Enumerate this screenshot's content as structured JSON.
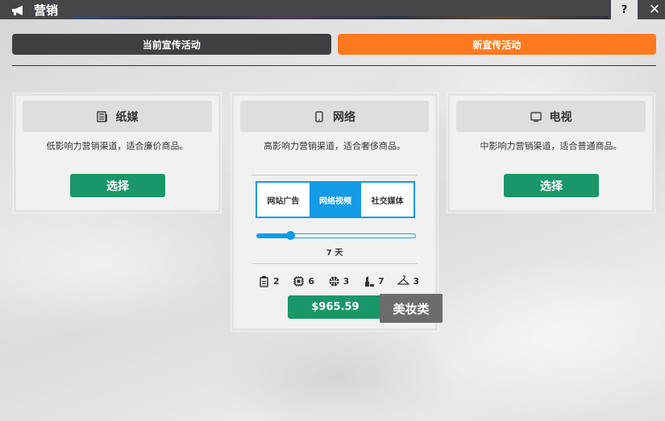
{
  "window": {
    "title": "营销",
    "icon": "megaphone-icon",
    "help_label": "?",
    "close_label": "✕"
  },
  "tabs": [
    {
      "label": "当前宣传活动",
      "active": false
    },
    {
      "label": "新宣传活动",
      "active": true,
      "color": "#ff7a1f"
    }
  ],
  "channels": [
    {
      "name": "纸媒",
      "icon": "newspaper-icon",
      "description": "低影响力营销渠道，适合廉价商品。",
      "button_label": "选择"
    },
    {
      "name": "网络",
      "icon": "smartphone-icon",
      "description": "高影响力营销渠道，适合奢侈商品。",
      "options": [
        "网站广告",
        "网络视频",
        "社交媒体"
      ],
      "selected_option": "网络视频",
      "duration": {
        "value": 7,
        "label": "7 天",
        "fraction": 0.21
      },
      "stats": [
        {
          "icon": "clipboard-icon",
          "value": "2"
        },
        {
          "icon": "chip-icon",
          "value": "6"
        },
        {
          "icon": "basketball-icon",
          "value": "3"
        },
        {
          "icon": "lipstick-icon",
          "value": "7"
        },
        {
          "icon": "hanger-icon",
          "value": "3"
        }
      ],
      "price": "$965.59"
    },
    {
      "name": "电视",
      "icon": "tv-icon",
      "description": "中影响力营销渠道，适合普通商品。",
      "button_label": "选择"
    }
  ],
  "tooltip": "美妆类",
  "colors": {
    "accent_orange": "#ff7a1f",
    "accent_green": "#1a9768",
    "accent_blue": "#149be6",
    "titlebar": "#45464a"
  }
}
